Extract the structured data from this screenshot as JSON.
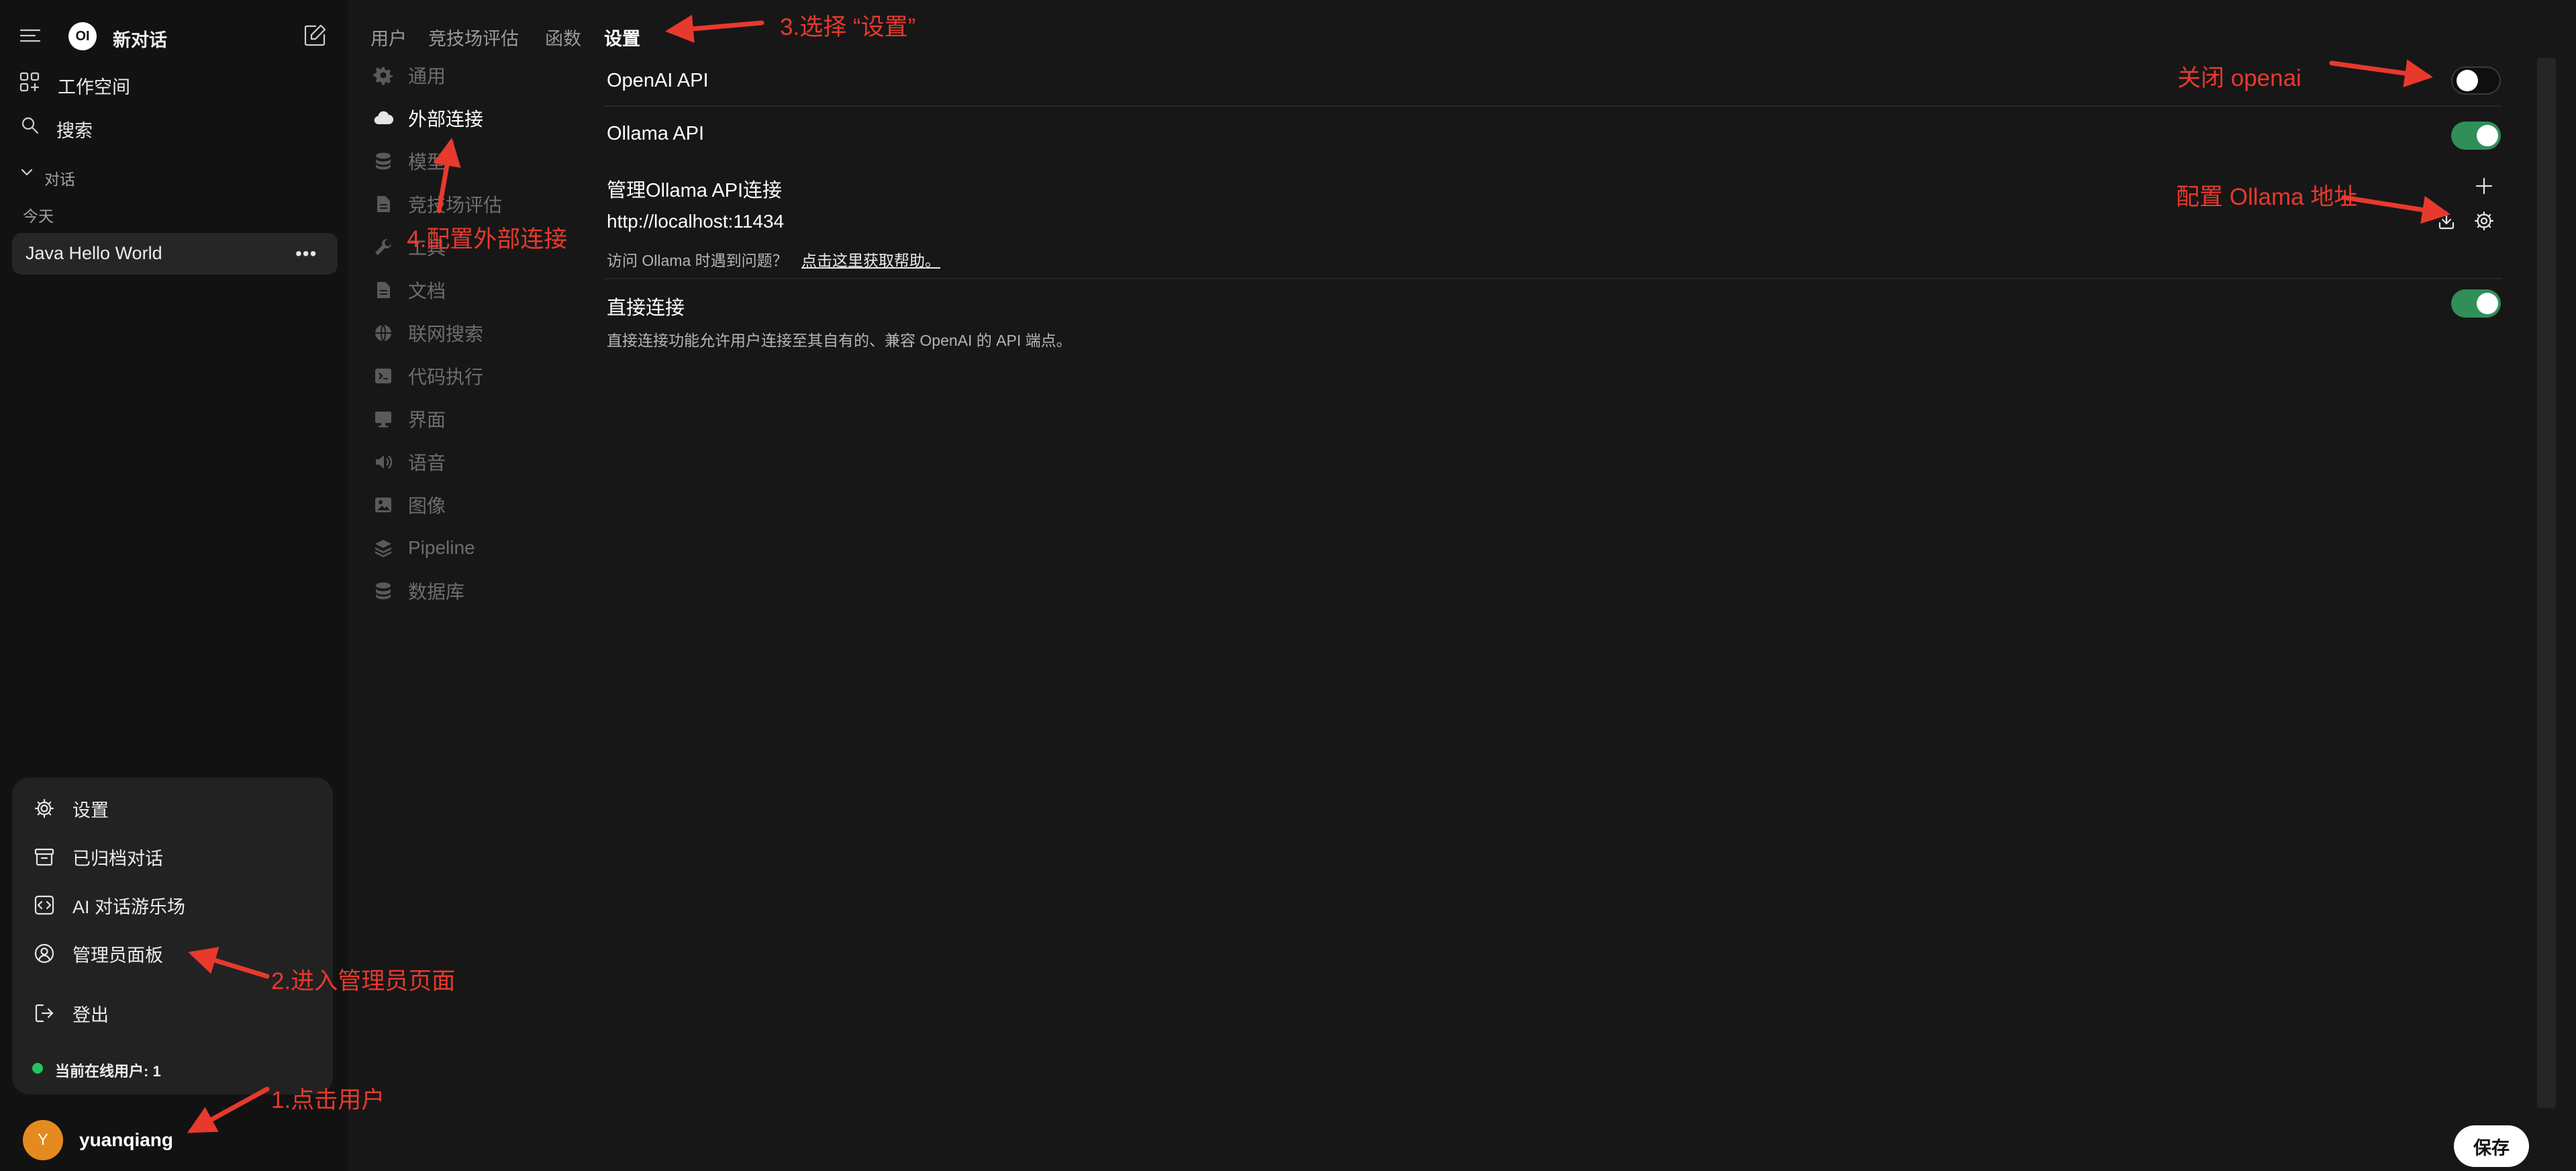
{
  "sidebar": {
    "new_chat": "新对话",
    "logo_text": "OI",
    "workspace": "工作空间",
    "search": "搜索",
    "chats_section": "对话",
    "today": "今天",
    "chat_item": "Java Hello World",
    "user_menu": {
      "items": [
        {
          "label": "设置",
          "icon": "gear-icon"
        },
        {
          "label": "已归档对话",
          "icon": "archive-icon"
        },
        {
          "label": "AI 对话游乐场",
          "icon": "code-icon"
        },
        {
          "label": "管理员面板",
          "icon": "user-circle-icon"
        },
        {
          "label": "登出",
          "icon": "logout-icon"
        }
      ],
      "online_users": "当前在线用户: 1"
    },
    "user": {
      "name": "yuanqiang",
      "avatar_letter": "Y",
      "avatar_color": "#e58a1f"
    }
  },
  "admin_tabs": [
    "用户",
    "竞技场评估",
    "函数",
    "设置"
  ],
  "settings_nav": [
    {
      "label": "通用",
      "icon": "gear-icon"
    },
    {
      "label": "外部连接",
      "icon": "cloud-icon"
    },
    {
      "label": "模型",
      "icon": "stack-icon"
    },
    {
      "label": "竞技场评估",
      "icon": "document-icon"
    },
    {
      "label": "工具",
      "icon": "wrench-icon"
    },
    {
      "label": "文档",
      "icon": "document-icon"
    },
    {
      "label": "联网搜索",
      "icon": "globe-icon"
    },
    {
      "label": "代码执行",
      "icon": "terminal-icon"
    },
    {
      "label": "界面",
      "icon": "monitor-icon"
    },
    {
      "label": "语音",
      "icon": "speaker-icon"
    },
    {
      "label": "图像",
      "icon": "image-icon"
    },
    {
      "label": "Pipeline",
      "icon": "layers-icon"
    },
    {
      "label": "数据库",
      "icon": "database-icon"
    }
  ],
  "connections": {
    "openai_label": "OpenAI API",
    "openai_enabled": false,
    "ollama_label": "Ollama API",
    "ollama_enabled": true,
    "manage_label": "管理Ollama API连接",
    "ollama_url": "http://localhost:11434",
    "help_text": "访问 Ollama 时遇到问题？",
    "help_link": "点击这里获取帮助。",
    "direct_label": "直接连接",
    "direct_desc": "直接连接功能允许用户连接至其自有的、兼容 OpenAI 的 API 端点。",
    "direct_enabled": true
  },
  "save_label": "保存",
  "annotations": {
    "step1": "1.点击用户",
    "step2": "2.进入管理员页面",
    "step3": "3.选择 “设置”",
    "step4": "4.配置外部连接",
    "close_openai": "关闭 openai",
    "config_ollama": "配置 Ollama 地址",
    "color": "#e8392d"
  },
  "colors": {
    "toggle_on": "#2f8f57",
    "background": "#171717",
    "sidebar": "#121212"
  }
}
